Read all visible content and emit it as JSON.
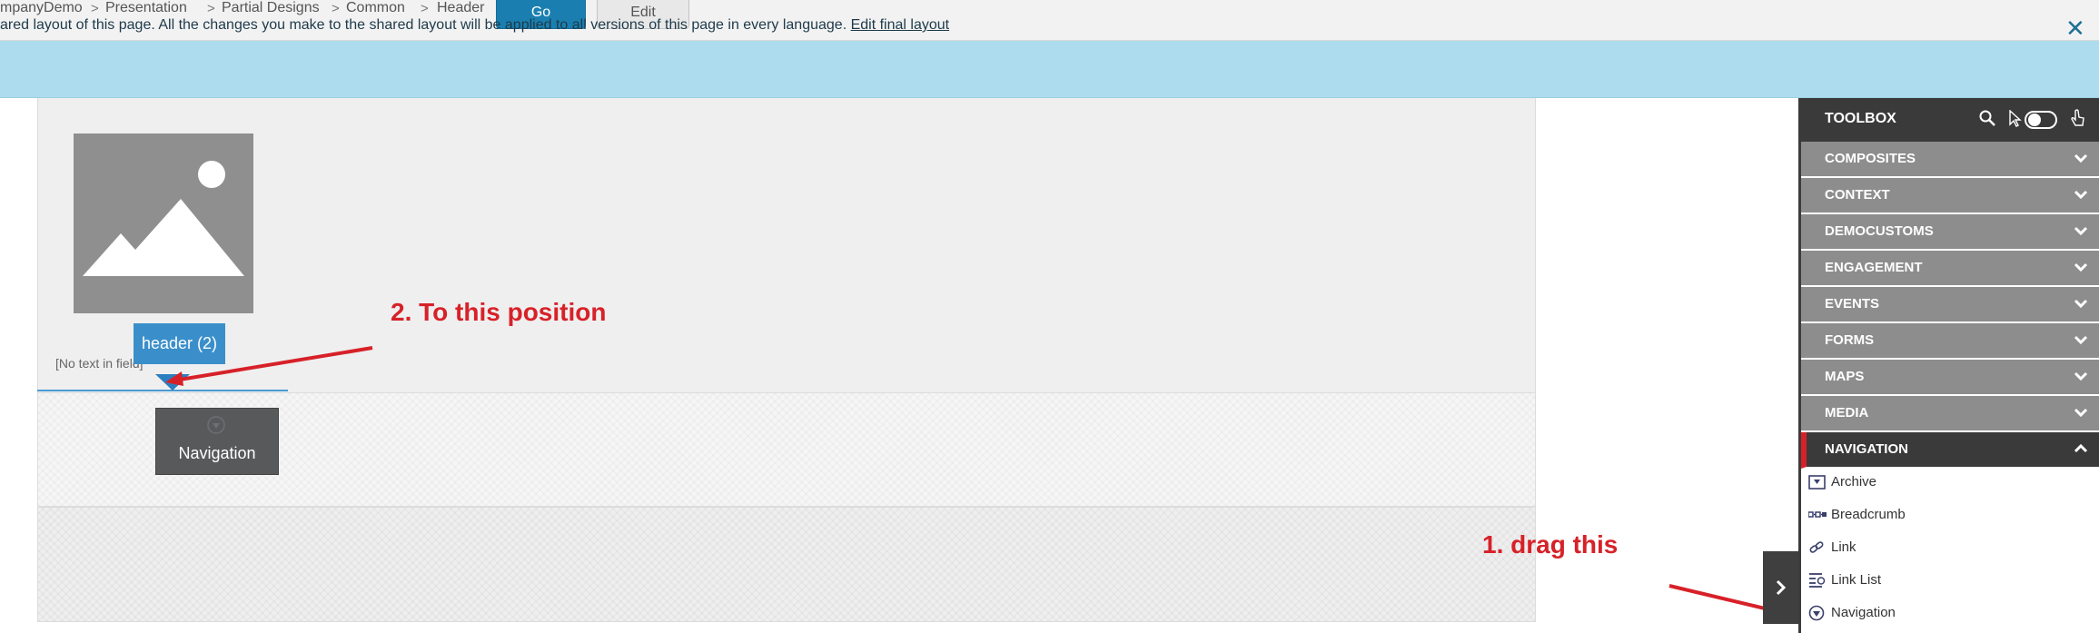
{
  "breadcrumb": [
    {
      "label": "mpanyDemo"
    },
    {
      "label": "Presentation"
    },
    {
      "label": "Partial Designs"
    },
    {
      "label": "Common"
    },
    {
      "label": "Header"
    }
  ],
  "breadcrumb_separator": ">",
  "toolbar": {
    "go_label": "Go",
    "edit_label": "Edit"
  },
  "notice": {
    "text": "ared layout of this page. All the changes you make to the shared layout will be applied to all versions of this page in every language.",
    "link_label": "Edit final layout",
    "close_symbol": "✕"
  },
  "canvas": {
    "rendering_label": "header (2)",
    "empty_field_text": "[No text in field]",
    "dragged_component_label": "Navigation"
  },
  "annotations": {
    "step1": "1. drag this",
    "step2": "2. To this position",
    "color": "#d72128"
  },
  "toolbox": {
    "title": "TOOLBOX",
    "header_icons": [
      "search-icon",
      "pointer-icon",
      "toggle-switch",
      "hand-pointer-icon"
    ],
    "categories": [
      {
        "label": "COMPOSITES",
        "expanded": false
      },
      {
        "label": "CONTEXT",
        "expanded": false
      },
      {
        "label": "DEMOCUSTOMS",
        "expanded": false
      },
      {
        "label": "ENGAGEMENT",
        "expanded": false
      },
      {
        "label": "EVENTS",
        "expanded": false
      },
      {
        "label": "FORMS",
        "expanded": false
      },
      {
        "label": "MAPS",
        "expanded": false
      },
      {
        "label": "MEDIA",
        "expanded": false
      },
      {
        "label": "NAVIGATION",
        "expanded": true
      }
    ],
    "navigation_items": [
      {
        "label": "Archive",
        "icon": "archive-icon"
      },
      {
        "label": "Breadcrumb",
        "icon": "breadcrumb-icon"
      },
      {
        "label": "Link",
        "icon": "link-icon"
      },
      {
        "label": "Link List",
        "icon": "link-list-icon"
      },
      {
        "label": "Navigation",
        "icon": "navigation-icon"
      }
    ]
  },
  "colors": {
    "accent_blue": "#1a7fb0",
    "notice_bg": "#aedcef",
    "toolbox_dark": "#3a3a3a",
    "category_gray": "#8d8d8d",
    "active_marker": "#d72128"
  }
}
